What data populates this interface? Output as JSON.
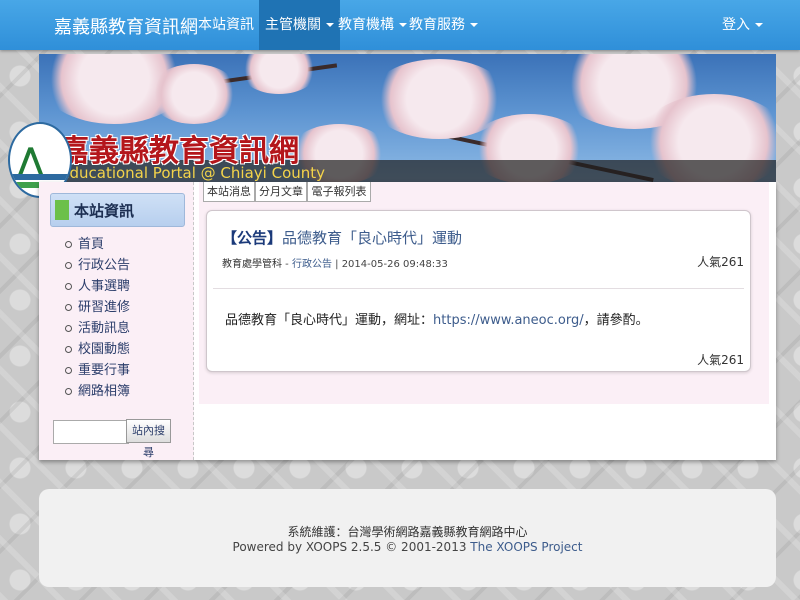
{
  "navbar": {
    "brand": "嘉義縣教育資訊網",
    "items": [
      {
        "label": "本站資訊"
      },
      {
        "label": "主管機關"
      },
      {
        "label": "教育機構"
      },
      {
        "label": "教育服務"
      }
    ],
    "login": "登入"
  },
  "banner": {
    "title": "嘉義縣教育資訊網",
    "subtitle": "Educational Portal @ Chiayi County"
  },
  "sidebar": {
    "header": "本站資訊",
    "items": [
      {
        "label": "首頁"
      },
      {
        "label": "行政公告"
      },
      {
        "label": "人事選聘"
      },
      {
        "label": "研習進修"
      },
      {
        "label": "活動訊息"
      },
      {
        "label": "校園動態"
      },
      {
        "label": "重要行事"
      },
      {
        "label": "網路相簿"
      }
    ],
    "search_button": "站內搜尋",
    "search_value": ""
  },
  "tabs": [
    {
      "label": "本站消息"
    },
    {
      "label": "分月文章"
    },
    {
      "label": "電子報列表"
    }
  ],
  "post": {
    "tag": "【公告】",
    "title": "品德教育「良心時代」運動",
    "author": "教育處學管科",
    "separator": " - ",
    "category": "行政公告",
    "datetime": " | 2014-05-26 09:48:33",
    "popularity_top": "人氣261",
    "body_prefix": "品德教育「良心時代」運動，網址：",
    "body_link": "https://www.aneoc.org/",
    "body_suffix": "，請參酌。",
    "popularity_bottom": "人氣261"
  },
  "footer": {
    "line1": "系統維護：台灣學術網路嘉義縣教育網路中心",
    "powered_prefix": "Powered by XOOPS 2.5.5 © 2001-2013 ",
    "project": "The XOOPS Project"
  }
}
